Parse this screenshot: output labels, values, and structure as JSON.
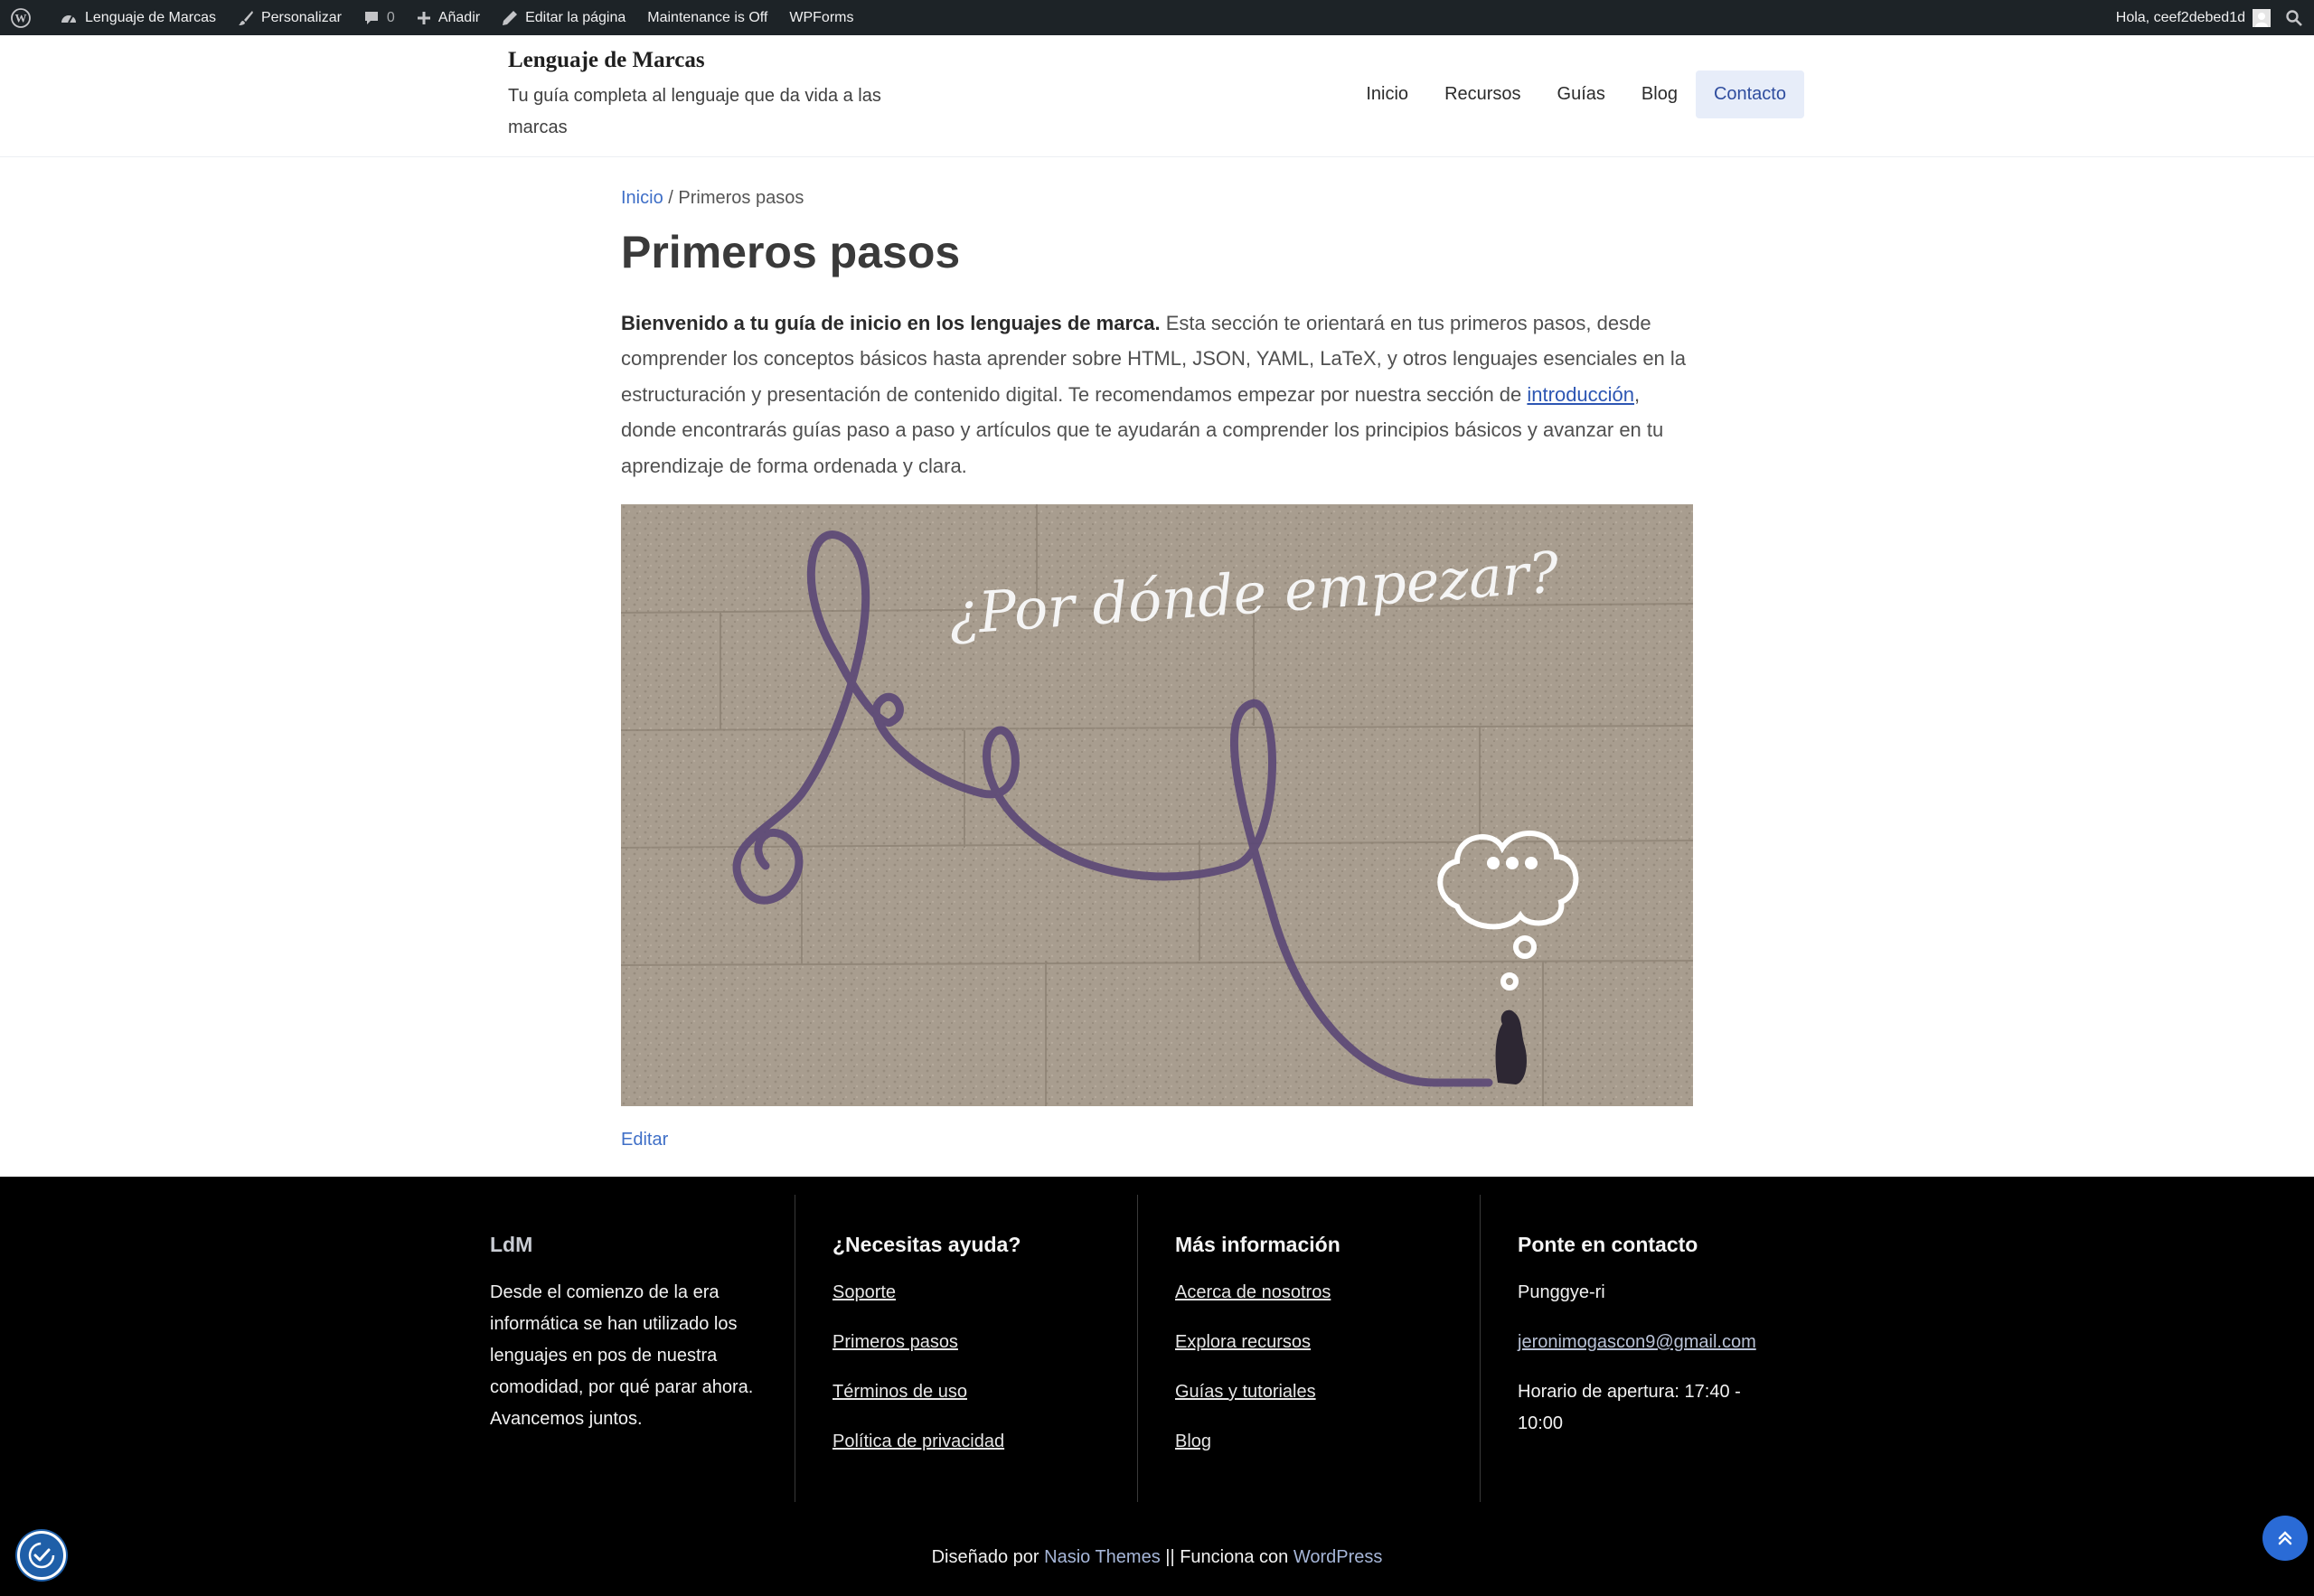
{
  "adminbar": {
    "site_name": "Lenguaje de Marcas",
    "customize": "Personalizar",
    "comments_count": "0",
    "add_new": "Añadir",
    "edit_page": "Editar la página",
    "maintenance": "Maintenance is Off",
    "wpforms": "WPForms",
    "greeting": "Hola, ceef2debed1d"
  },
  "header": {
    "site_title": "Lenguaje de Marcas",
    "site_description": "Tu guía completa al lenguaje que da vida a las marcas",
    "nav": [
      "Inicio",
      "Recursos",
      "Guías",
      "Blog",
      "Contacto"
    ],
    "active_nav": "Contacto"
  },
  "main": {
    "breadcrumb": {
      "home": "Inicio",
      "separator": "/",
      "current": "Primeros pasos"
    },
    "title": "Primeros pasos",
    "intro_bold": "Bienvenido a tu guía de inicio en los lenguajes de marca.",
    "intro_text1": " Esta sección te orientará en tus primeros pasos, desde comprender los conceptos básicos hasta aprender sobre HTML, JSON, YAML, LaTeX, y otros lenguajes esenciales en la estructuración y presentación de contenido digital. Te recomendamos empezar por nuestra sección de ",
    "intro_link": "introducción",
    "intro_text2": ", donde encontrarás guías paso a paso y artículos que te ayudarán a comprender los principios básicos y avanzar en tu aprendizaje de forma ordenada y clara.",
    "hero_caption": "¿Por dónde empezar?",
    "edit": "Editar"
  },
  "footer": {
    "col1": {
      "heading": "LdM",
      "text": "Desde el comienzo de la era informática se han utilizado los lenguajes en pos de nuestra comodidad, por qué parar ahora. Avancemos juntos."
    },
    "col2": {
      "heading": "¿Necesitas ayuda?",
      "links": [
        "Soporte",
        "Primeros pasos",
        "Términos de uso",
        "Política de privacidad"
      ]
    },
    "col3": {
      "heading": "Más información",
      "links": [
        "Acerca de nosotros",
        "Explora recursos",
        "Guías y tutoriales",
        "Blog"
      ]
    },
    "col4": {
      "heading": "Ponte en contacto",
      "location": "Punggye-ri",
      "email": "jeronimogascon9@gmail.com",
      "hours": "Horario de apertura: 17:40 - 10:00"
    },
    "credits": {
      "designed_by": "Diseñado por ",
      "theme": "Nasio Themes",
      "powered": " || Funciona con ",
      "wp": "WordPress"
    }
  },
  "colors": {
    "adminbar_bg": "#1d2327",
    "footer_bg": "#000000",
    "accent": "#3f6fc7",
    "nav_active_bg": "#e7edf9"
  }
}
